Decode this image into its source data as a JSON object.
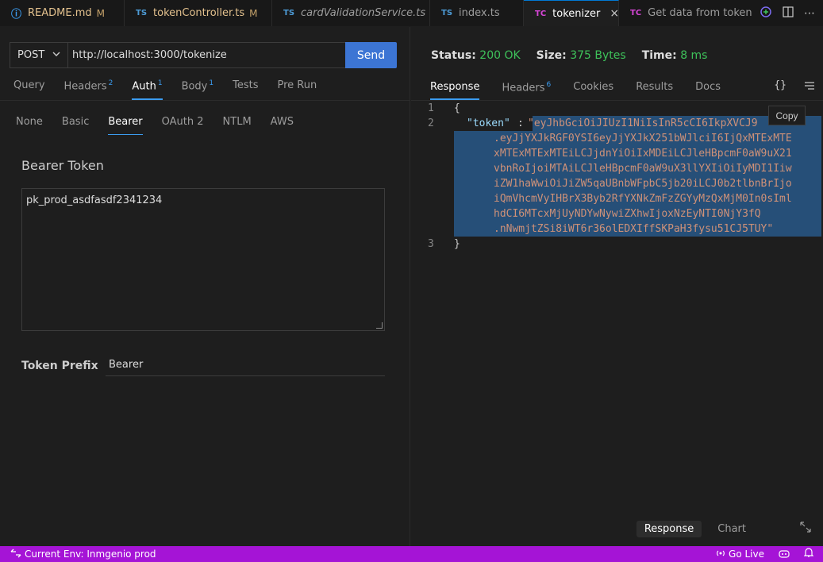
{
  "tabs": [
    {
      "icon": "info-icon",
      "icon_glyph": "ⓘ",
      "label": "README.md",
      "modified": "M"
    },
    {
      "icon": "ts",
      "label": "tokenController.ts",
      "modified": "M"
    },
    {
      "icon": "ts",
      "label": "cardValidationService.ts"
    },
    {
      "icon": "ts",
      "label": "index.ts"
    },
    {
      "icon": "tc",
      "label": "tokenizer",
      "close": "×"
    },
    {
      "icon": "tc",
      "label": "Get data from token"
    }
  ],
  "icon_labels": {
    "ts": "TS",
    "tc": "TC"
  },
  "request": {
    "method": "POST",
    "url": "http://localhost:3000/tokenize",
    "send_label": "Send",
    "tabs": [
      {
        "label": "Query"
      },
      {
        "label": "Headers",
        "count": "2"
      },
      {
        "label": "Auth",
        "count": "1"
      },
      {
        "label": "Body",
        "count": "1"
      },
      {
        "label": "Tests"
      },
      {
        "label": "Pre Run"
      }
    ],
    "auth_tabs": [
      "None",
      "Basic",
      "Bearer",
      "OAuth 2",
      "NTLM",
      "AWS"
    ],
    "bearer_label": "Bearer Token",
    "bearer_token": "pk_prod_asdfasdf2341234",
    "prefix_label": "Token Prefix",
    "prefix_value": "Bearer"
  },
  "response": {
    "status_label": "Status:",
    "status_value": "200 OK",
    "size_label": "Size:",
    "size_value": "375 Bytes",
    "time_label": "Time:",
    "time_value": "8 ms",
    "tabs": [
      {
        "label": "Response"
      },
      {
        "label": "Headers",
        "count": "6"
      },
      {
        "label": "Cookies"
      },
      {
        "label": "Results"
      },
      {
        "label": "Docs"
      }
    ],
    "copy_label": "Copy",
    "line_numbers": [
      "1",
      "2",
      "3"
    ],
    "open_brace": "{",
    "close_brace": "}",
    "key_text": "\"token\"",
    "colon": ": ",
    "token_lines": [
      "\"eyJhbGciOiJIUzI1NiIsInR5cCI6IkpXVCJ9",
      ".eyJjYXJkRGF0YSI6eyJjYXJkX251bWJlciI6IjQxMTExMTE",
      "xMTExMTExMTEiLCJjdnYiOiIxMDEiLCJleHBpcmF0aW9uX21",
      "vbnRoIjoiMTAiLCJleHBpcmF0aW9uX3llYXIiOiIyMDI1Iiw",
      "iZW1haWwiOiJiZW5qaUBnbWFpbC5jb20iLCJ0b2tlbnBrIjo",
      "iQmVhcmVyIHBrX3Byb2RfYXNkZmFzZGYyMzQxMjM0In0sIml",
      "hdCI6MTcxMjUyNDYwNywiZXhwIjoxNzEyNTI0NjY3fQ",
      ".nNwmjtZSi8iWT6r36olEDXIffSKPaH3fysu51CJ5TUY\""
    ],
    "view_options": [
      "Response",
      "Chart"
    ]
  },
  "statusbar": {
    "env": "Current Env: Inmgenio prod",
    "golive": "Go Live"
  },
  "colors": {
    "accent": "#3b9cf0",
    "status_ok": "#3ec15a",
    "statusbar": "#a514d6",
    "send": "#3c75d4"
  }
}
